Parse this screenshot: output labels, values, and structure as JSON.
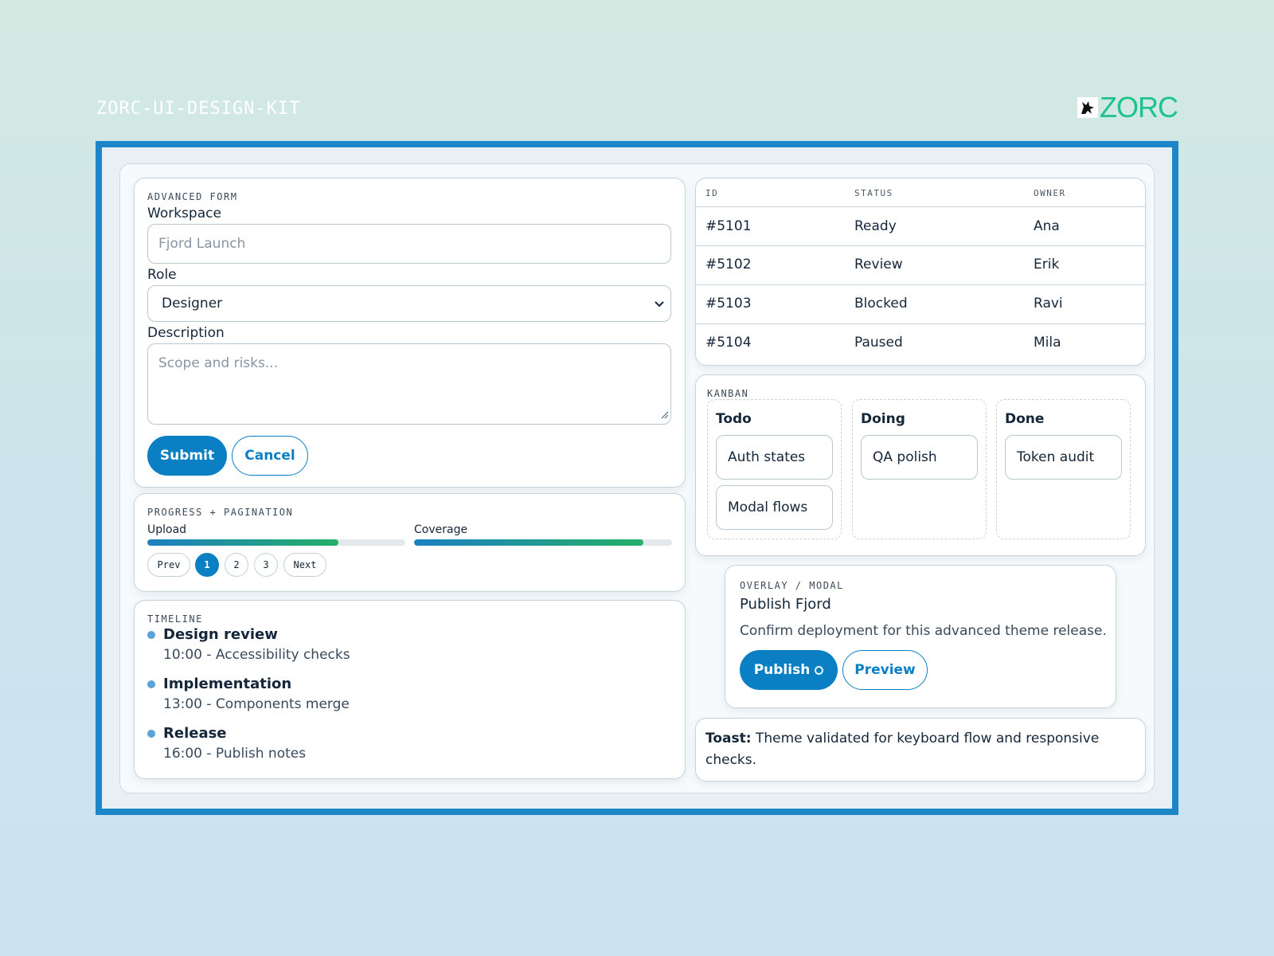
{
  "header": {
    "kit_label": "ZORC-UI-DESIGN-KIT",
    "logo_text": "ZORC"
  },
  "colors": {
    "accent": "#0b7fc4",
    "frame": "#1d86c9",
    "brand_green": "#1cc48a"
  },
  "form": {
    "section_title": "ADVANCED FORM",
    "workspace_label": "Workspace",
    "workspace_placeholder": "Fjord Launch",
    "role_label": "Role",
    "role_value": "Designer",
    "description_label": "Description",
    "description_placeholder": "Scope and risks...",
    "submit_label": "Submit",
    "cancel_label": "Cancel"
  },
  "progress": {
    "section_title": "PROGRESS + PAGINATION",
    "bars": [
      {
        "label": "Upload",
        "value": 0.74
      },
      {
        "label": "Coverage",
        "value": 0.89
      }
    ],
    "pagination": {
      "prev": "Prev",
      "pages": [
        "1",
        "2",
        "3"
      ],
      "current": "1",
      "next": "Next"
    }
  },
  "timeline": {
    "section_title": "TIMELINE",
    "items": [
      {
        "title": "Design review",
        "detail": "10:00 - Accessibility checks"
      },
      {
        "title": "Implementation",
        "detail": "13:00 - Components merge"
      },
      {
        "title": "Release",
        "detail": "16:00 - Publish notes"
      }
    ]
  },
  "table": {
    "headers": [
      "ID",
      "STATUS",
      "OWNER"
    ],
    "rows": [
      [
        "#5101",
        "Ready",
        "Ana"
      ],
      [
        "#5102",
        "Review",
        "Erik"
      ],
      [
        "#5103",
        "Blocked",
        "Ravi"
      ],
      [
        "#5104",
        "Paused",
        "Mila"
      ]
    ]
  },
  "kanban": {
    "section_title": "KANBAN",
    "columns": [
      {
        "title": "Todo",
        "cards": [
          "Auth states",
          "Modal flows"
        ]
      },
      {
        "title": "Doing",
        "cards": [
          "QA polish"
        ]
      },
      {
        "title": "Done",
        "cards": [
          "Token audit"
        ]
      }
    ]
  },
  "modal": {
    "section_title": "OVERLAY / MODAL",
    "title": "Publish Fjord",
    "body": "Confirm deployment for this advanced theme release.",
    "publish_label": "Publish",
    "preview_label": "Preview"
  },
  "toast": {
    "prefix": "Toast:",
    "message": "Theme validated for keyboard flow and responsive checks."
  }
}
